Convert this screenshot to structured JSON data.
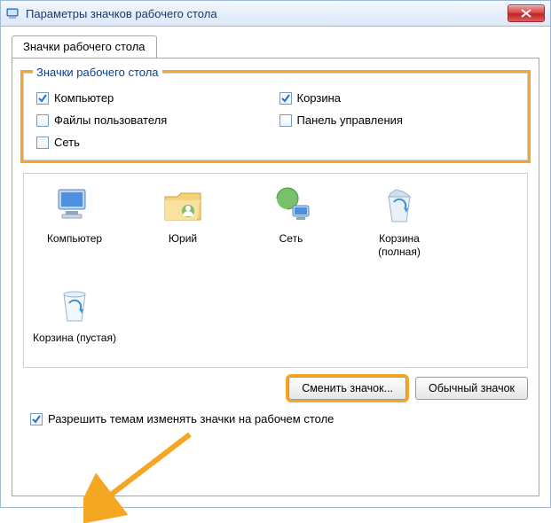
{
  "titlebar": {
    "title": "Параметры значков рабочего стола"
  },
  "tab": {
    "label": "Значки рабочего стола"
  },
  "group": {
    "legend": "Значки рабочего стола",
    "items": [
      {
        "label": "Компьютер",
        "checked": true
      },
      {
        "label": "Корзина",
        "checked": true
      },
      {
        "label": "Файлы пользователя",
        "checked": false
      },
      {
        "label": "Панель управления",
        "checked": false
      },
      {
        "label": "Сеть",
        "checked": false
      }
    ]
  },
  "icons": {
    "items": [
      {
        "label": "Компьютер",
        "kind": "computer"
      },
      {
        "label": "Юрий",
        "kind": "userfolder"
      },
      {
        "label": "Сеть",
        "kind": "network"
      },
      {
        "label": "Корзина (полная)",
        "kind": "recycle-full"
      },
      {
        "label": "Корзина (пустая)",
        "kind": "recycle-empty"
      }
    ]
  },
  "buttons": {
    "change": "Сменить значок...",
    "default": "Обычный значок"
  },
  "allow_themes": {
    "label": "Разрешить темам изменять значки на рабочем столе",
    "checked": true
  }
}
